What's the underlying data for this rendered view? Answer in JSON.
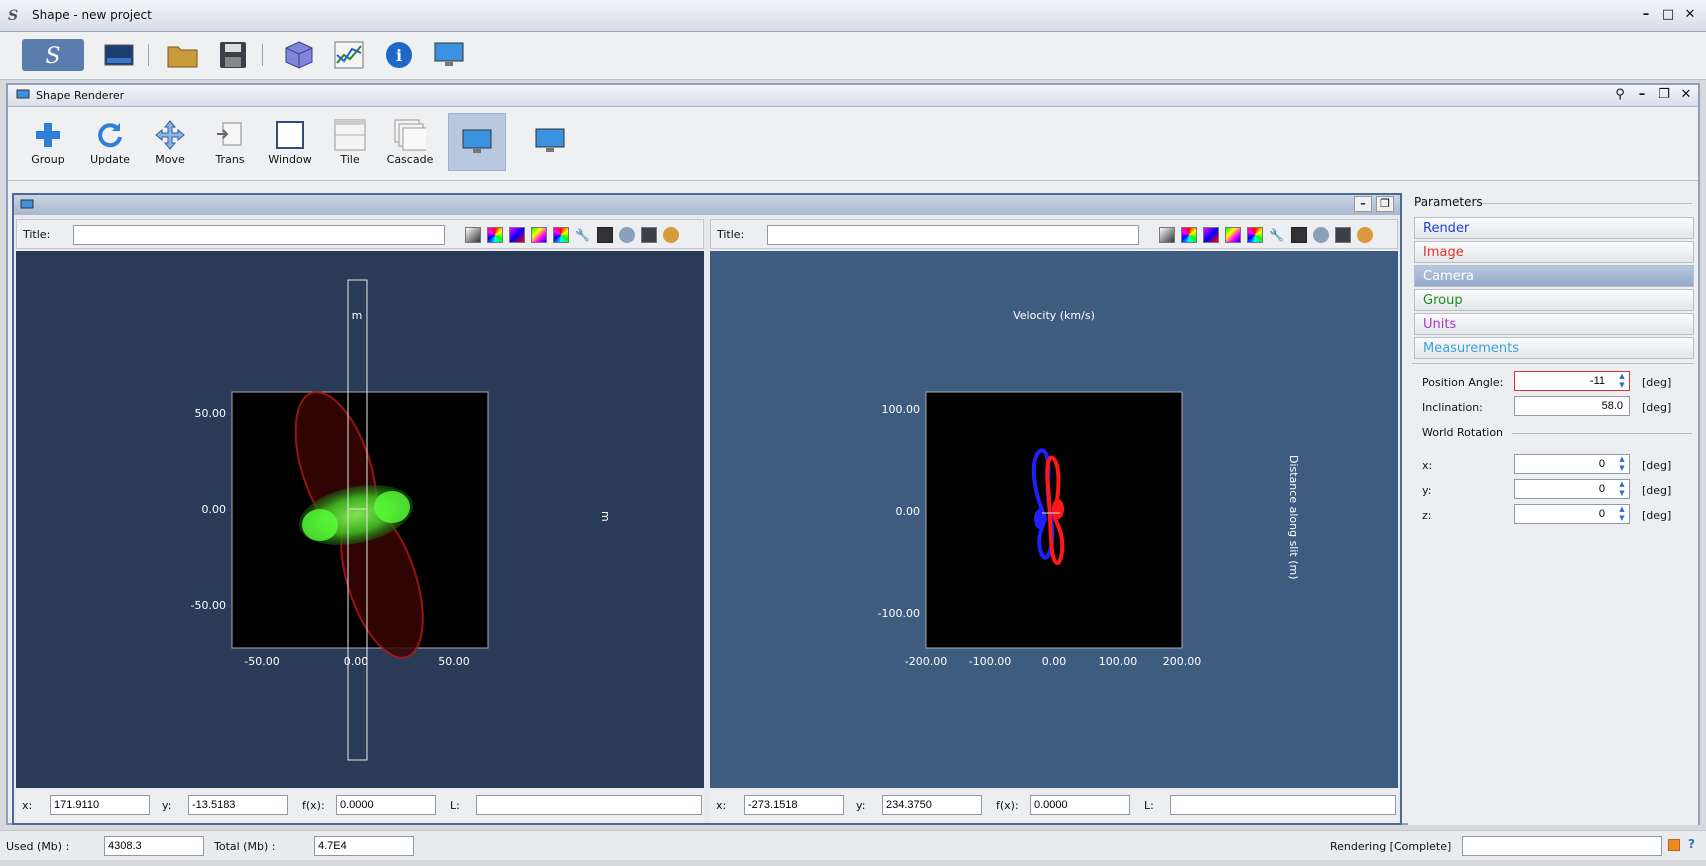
{
  "app": {
    "title": "Shape - new project",
    "logo": "S"
  },
  "window_controls": [
    "minimize-icon",
    "maximize-icon",
    "close-icon"
  ],
  "main_toolbar": [
    "shape-logo-icon",
    "image-icon",
    "folder-icon",
    "save-icon",
    "cube-icon",
    "graph-icon",
    "info-icon",
    "monitor-icon"
  ],
  "renderer": {
    "title": "Shape Renderer",
    "buttons": [
      {
        "label": "Group",
        "icon": "plus-icon"
      },
      {
        "label": "Update",
        "icon": "refresh-icon"
      },
      {
        "label": "Move",
        "icon": "move-icon"
      },
      {
        "label": "Trans",
        "icon": "trans-icon"
      },
      {
        "label": "Window",
        "icon": "window-icon"
      },
      {
        "label": "Tile",
        "icon": "tile-icon"
      },
      {
        "label": "Cascade",
        "icon": "cascade-icon"
      },
      {
        "label": "",
        "icon": "monitor-icon"
      },
      {
        "label": "",
        "icon": "monitor-icon"
      }
    ]
  },
  "left_panel": {
    "title_label": "Title:",
    "title_value": "",
    "slit_label": "m",
    "right_label": "m",
    "x_ticks": [
      "-50.00",
      "0.00",
      "50.00"
    ],
    "y_ticks": [
      "50.00",
      "0.00",
      "-50.00"
    ],
    "x_label": "x:",
    "x_value": "171.9110",
    "y_label": "y:",
    "y_value": "-13.5183",
    "fx_label": "f(x):",
    "fx_value": "0.0000",
    "l_label": "L:",
    "l_value": ""
  },
  "right_panel": {
    "title_label": "Title:",
    "title_value": "",
    "top_label": "Velocity (km/s)",
    "side_label": "Distance along slit (m)",
    "x_ticks": [
      "-200.00",
      "-100.00",
      "0.00",
      "100.00",
      "200.00"
    ],
    "y_ticks": [
      "100.00",
      "0.00",
      "-100.00"
    ],
    "x_label": "x:",
    "x_value": "-273.1518",
    "y_label": "y:",
    "y_value": "234.3750",
    "fx_label": "f(x):",
    "fx_value": "0.0000",
    "l_label": "L:",
    "l_value": ""
  },
  "parameters": {
    "header": "Parameters",
    "tabs": [
      {
        "label": "Render",
        "color": "#1f3fd6"
      },
      {
        "label": "Image",
        "color": "#e0302a"
      },
      {
        "label": "Camera",
        "color": "#ffffff"
      },
      {
        "label": "Group",
        "color": "#1f8a1f"
      },
      {
        "label": "Units",
        "color": "#b030d0"
      },
      {
        "label": "Measurements",
        "color": "#3aa0d8"
      }
    ],
    "position_angle": {
      "label": "Position Angle:",
      "value": "-11",
      "unit": "[deg]"
    },
    "inclination": {
      "label": "Inclination:",
      "value": "58.0",
      "unit": "[deg]"
    },
    "world_rotation": {
      "header": "World Rotation",
      "x": {
        "label": "x:",
        "value": "0",
        "unit": "[deg]"
      },
      "y": {
        "label": "y:",
        "value": "0",
        "unit": "[deg]"
      },
      "z": {
        "label": "z:",
        "value": "0",
        "unit": "[deg]"
      }
    }
  },
  "status": {
    "used_label": "Used (Mb) :",
    "used_value": "4308.3",
    "total_label": "Total (Mb) :",
    "total_value": "4.7E4",
    "rendering": "Rendering [Complete]"
  }
}
